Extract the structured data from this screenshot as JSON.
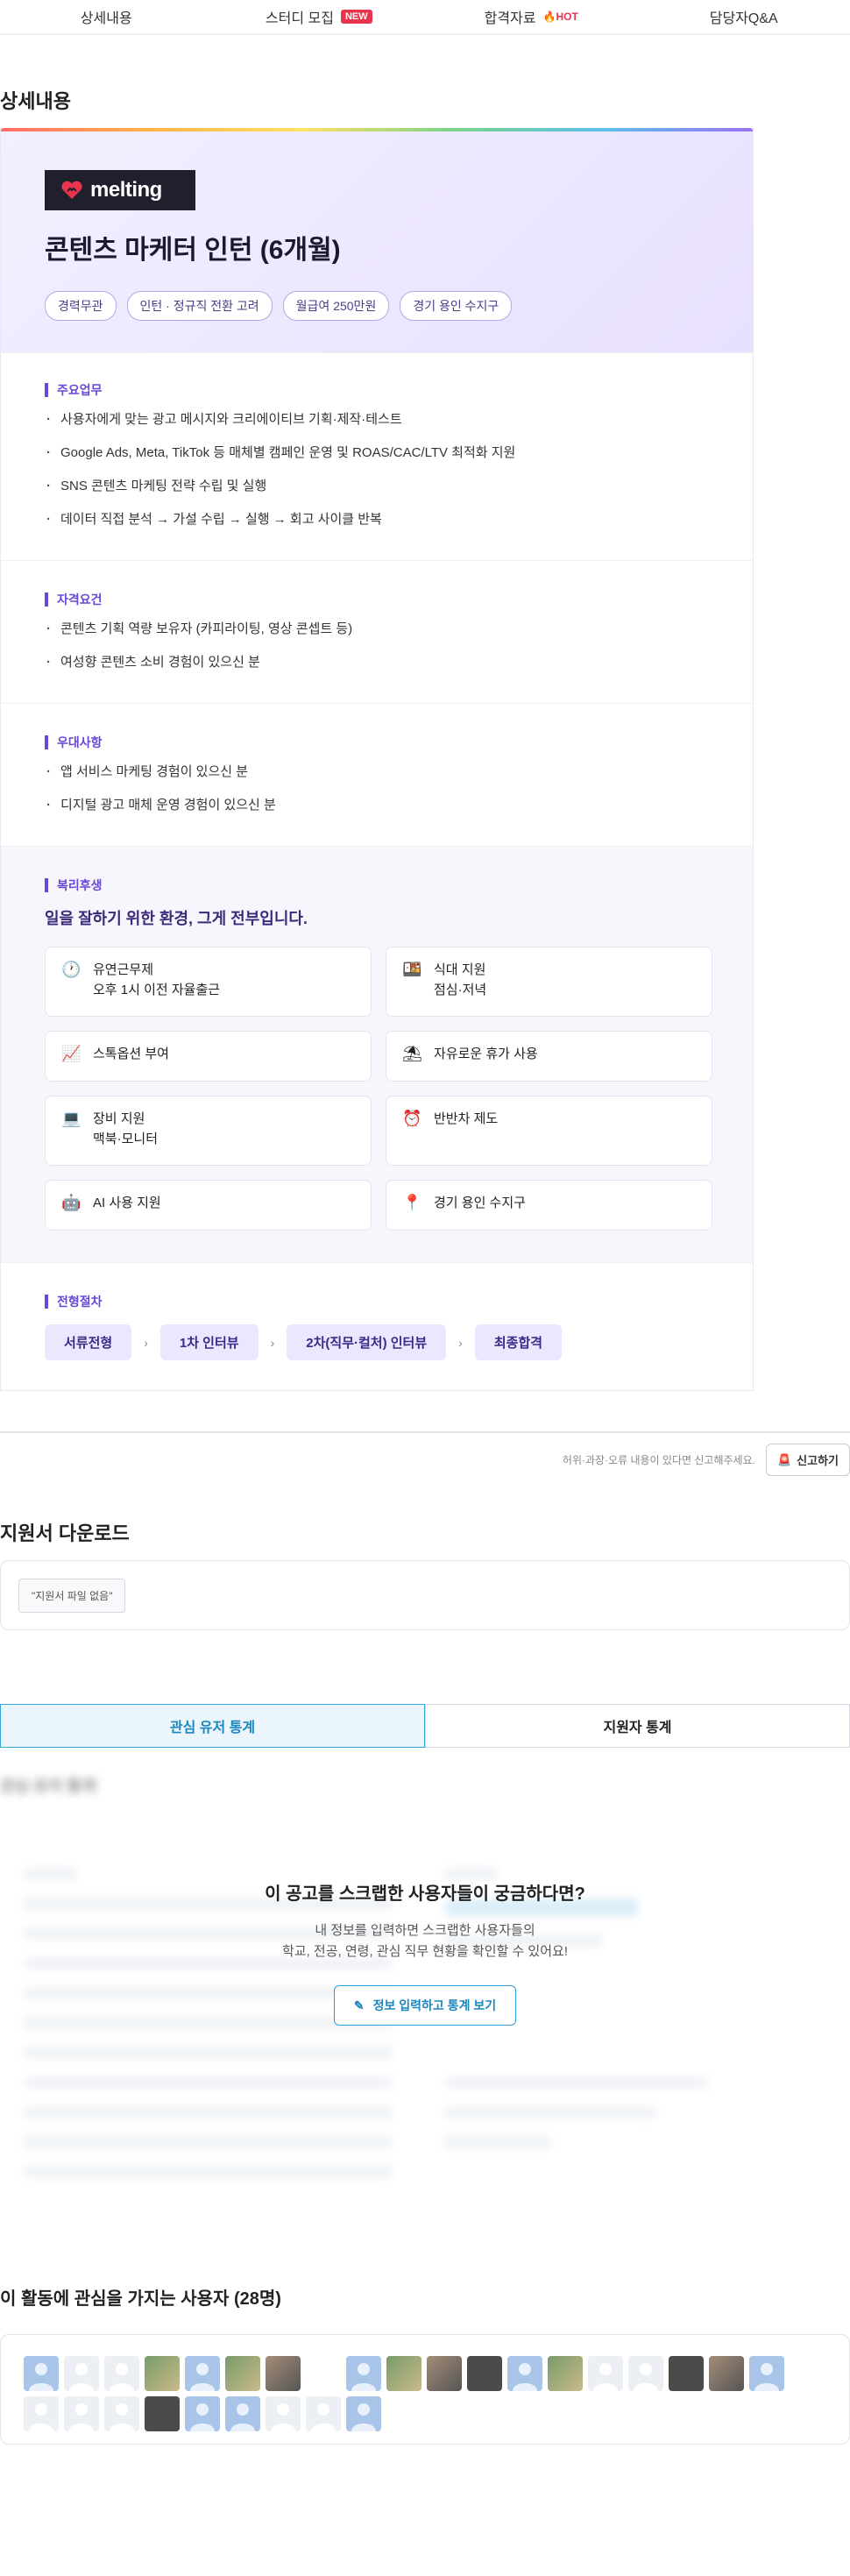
{
  "nav": {
    "items": [
      {
        "label": "상세내용"
      },
      {
        "label": "스터디 모집",
        "badge": "NEW"
      },
      {
        "label": "합격자료",
        "badge": "HOT"
      },
      {
        "label": "담당자Q&A"
      }
    ]
  },
  "detail": {
    "section_title": "상세내용",
    "company_logo": "melting",
    "job_title": "콘텐츠 마케터 인턴 (6개월)",
    "tags": [
      "경력무관",
      "인턴 · 정규직 전환 고려",
      "월급여 250만원",
      "경기 용인 수지구"
    ],
    "duties": {
      "label": "주요업무",
      "items": [
        "사용자에게 맞는 광고 메시지와 크리에이티브 기획·제작·테스트",
        "Google Ads, Meta, TikTok 등 매체별 캠페인 운영 및 ROAS/CAC/LTV 최적화 지원",
        "SNS 콘텐츠 마케팅 전략 수립 및 실행",
        "데이터 직접 분석 → 가설 수립 → 실행 → 회고 사이클 반복"
      ]
    },
    "qualifications": {
      "label": "자격요건",
      "items": [
        "콘텐츠 기획 역량 보유자 (카피라이팅, 영상 콘셉트 등)",
        "여성향 콘텐츠 소비 경험이 있으신 분"
      ]
    },
    "preferred": {
      "label": "우대사항",
      "items": [
        "앱 서비스 마케팅 경험이 있으신 분",
        "디지털 광고 매체 운영 경험이 있으신 분"
      ]
    },
    "benefits": {
      "label": "복리후생",
      "headline": "일을 잘하기 위한 환경, 그게 전부입니다.",
      "items": [
        {
          "icon": "clock-icon",
          "glyph": "🕐",
          "line1": "유연근무제",
          "line2": "오후 1시 이전 자율출근"
        },
        {
          "icon": "meal-icon",
          "glyph": "🍱",
          "line1": "식대 지원",
          "line2": "점심·저녁"
        },
        {
          "icon": "chart-icon",
          "glyph": "📈",
          "line1": "스톡옵션 부여",
          "line2": ""
        },
        {
          "icon": "beach-icon",
          "glyph": "⛱",
          "line1": "자유로운 휴가 사용",
          "line2": ""
        },
        {
          "icon": "laptop-icon",
          "glyph": "💻",
          "line1": "장비 지원",
          "line2": "맥북·모니터"
        },
        {
          "icon": "alarm-icon",
          "glyph": "⏰",
          "line1": "반반차 제도",
          "line2": ""
        },
        {
          "icon": "robot-icon",
          "glyph": "🤖",
          "line1": "AI 사용 지원",
          "line2": ""
        },
        {
          "icon": "pin-icon",
          "glyph": "📍",
          "line1": "경기 용인 수지구",
          "line2": ""
        }
      ]
    },
    "process": {
      "label": "전형절차",
      "steps": [
        "서류전형",
        "1차 인터뷰",
        "2차(직무·컬처) 인터뷰",
        "최종합격"
      ]
    }
  },
  "report": {
    "text": "허위·과장·오류 내용이 있다면 신고해주세요.",
    "button": "신고하기"
  },
  "download": {
    "title": "지원서 다운로드",
    "empty": "\"지원서 파일 없음\""
  },
  "stats": {
    "tabs": [
      "관심 유저 통계",
      "지원자 통계"
    ],
    "overlay_title": "이 공고를 스크랩한 사용자들이 궁금하다면?",
    "overlay_desc1": "내 정보를 입력하면 스크랩한 사용자들의",
    "overlay_desc2": "학교, 전공, 연령, 관심 직무 현황을 확인할 수 있어요!",
    "overlay_button": "정보 입력하고 통계 보기"
  },
  "users": {
    "title": "이 활동에 관심을 가지는 사용자 (28명)"
  }
}
